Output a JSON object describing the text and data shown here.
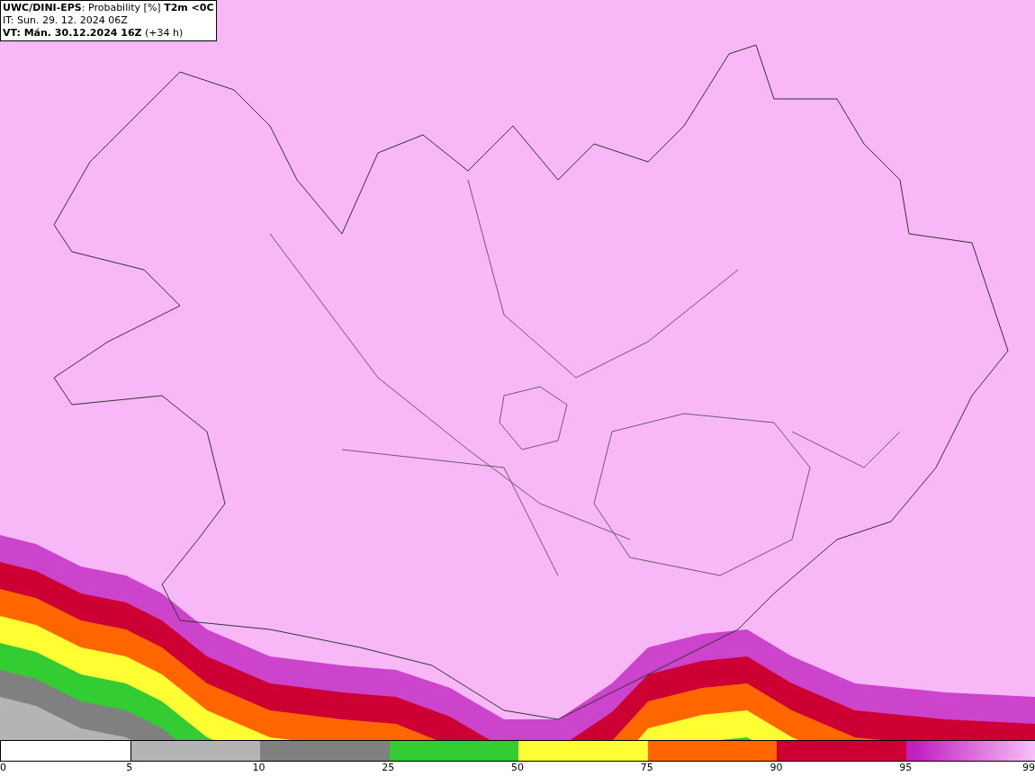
{
  "header": {
    "title": "**UWC/DINI-EPS**: Probability [%] **T2m <0C**",
    "issue_time": "IT: Sun. 29. 12. 2024 06Z",
    "valid_time": "**VT: Mán. 30.12.2024 16Z** (+34 h)"
  },
  "legend": {
    "segments": [
      {
        "kind": "solid",
        "color": "#ffffff"
      },
      {
        "kind": "solid",
        "color": "#b4b4b4"
      },
      {
        "kind": "solid",
        "color": "#808080"
      },
      {
        "kind": "solid",
        "color": "#33cc33"
      },
      {
        "kind": "solid",
        "color": "#ffff33"
      },
      {
        "kind": "solid",
        "color": "#ff6600"
      },
      {
        "kind": "solid",
        "color": "#cc0033"
      },
      {
        "kind": "gradient",
        "color": "#c020c0"
      }
    ],
    "ticks": [
      "0",
      "5",
      "10",
      "25",
      "50",
      "75",
      "90",
      "95",
      "99"
    ]
  }
}
